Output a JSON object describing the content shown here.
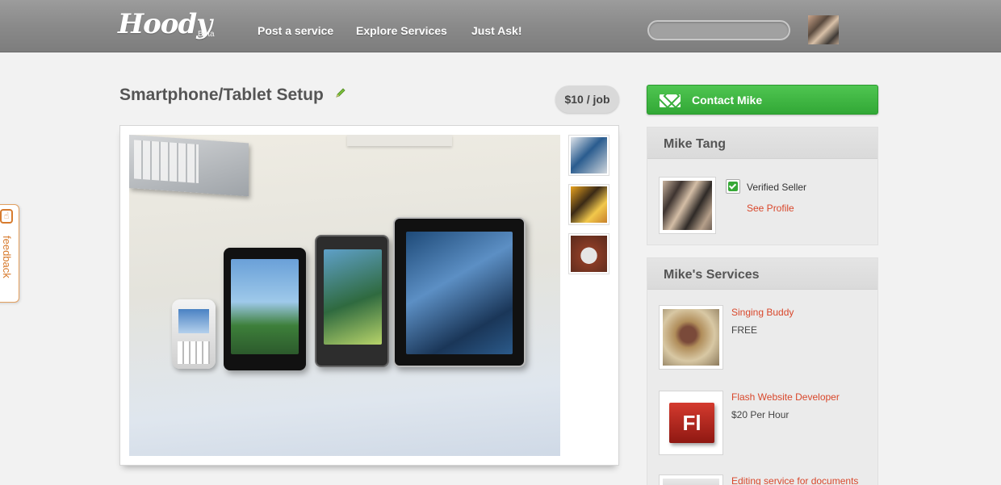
{
  "header": {
    "logo": "Hoody",
    "beta": "Beta",
    "nav": [
      "Post a service",
      "Explore Services",
      "Just Ask!"
    ],
    "search_placeholder": ""
  },
  "feedback": {
    "label": "feedback"
  },
  "service": {
    "title": "Smartphone/Tablet Setup",
    "price": "$10 / job"
  },
  "sidebar": {
    "contact_label": "Contact Mike",
    "seller": {
      "name": "Mike Tang",
      "verified": "Verified Seller",
      "profile_link": "See Profile"
    },
    "services_title": "Mike's Services",
    "services": [
      {
        "name": "Singing Buddy",
        "price": "FREE"
      },
      {
        "name": "Flash Website Developer",
        "price": "$20 Per Hour"
      },
      {
        "name": "Editing service for documents",
        "price": ""
      }
    ]
  },
  "colors": {
    "accent_link": "#d9472b",
    "contact_green": "#3bb03e",
    "feedback_orange": "#d77b2e"
  }
}
